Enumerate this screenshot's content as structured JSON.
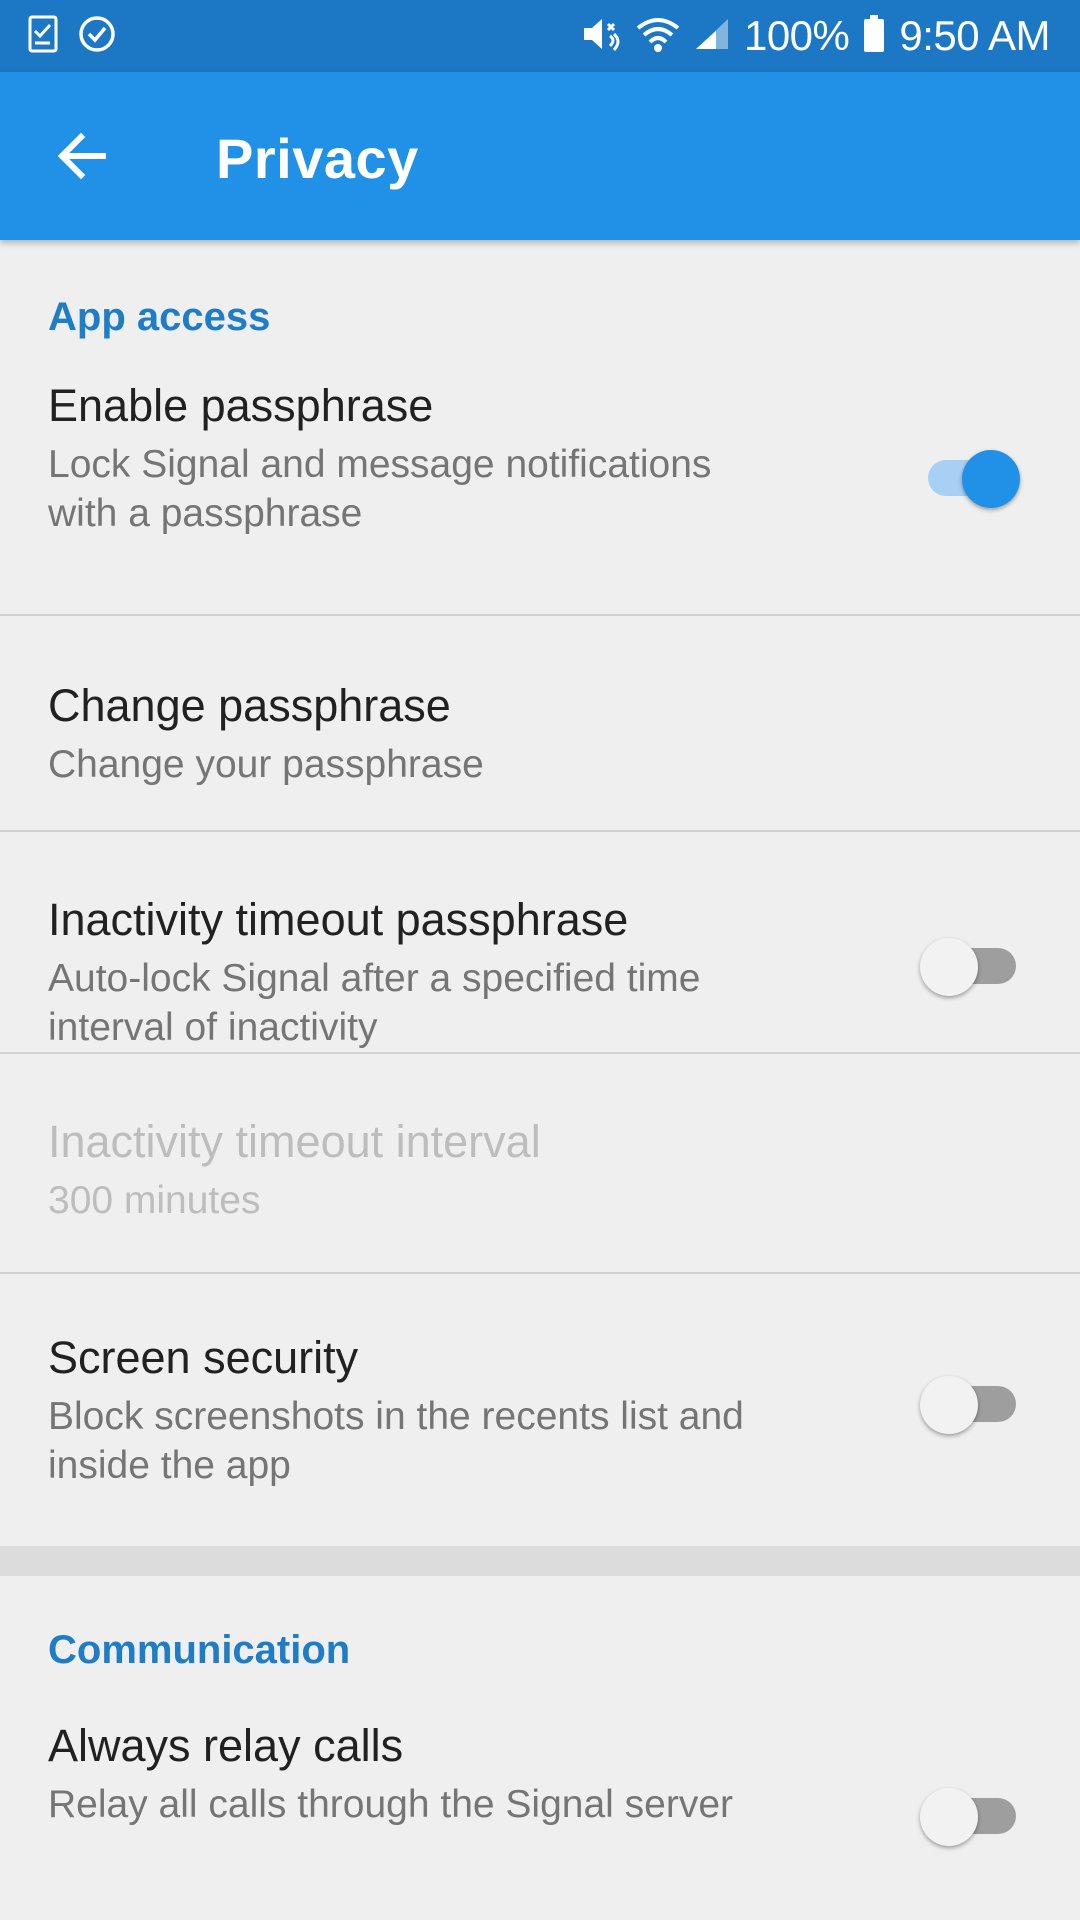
{
  "status_bar": {
    "battery": "100%",
    "time": "9:50 AM",
    "icons": [
      "task-check-icon",
      "check-circle-icon",
      "mute-vibrate-icon",
      "wifi-icon",
      "signal-icon",
      "battery-icon"
    ]
  },
  "app_bar": {
    "title": "Privacy",
    "back_icon": "arrow-left-icon",
    "color": "#2191e8"
  },
  "sections": {
    "app_access": {
      "header": "App access",
      "items": [
        {
          "title": "Enable passphrase",
          "summary_line1": "Lock Signal and message notifications",
          "summary_line2": "with a passphrase",
          "switch": "on"
        },
        {
          "title": "Change passphrase",
          "summary_line1": "Change your passphrase"
        },
        {
          "title": "Inactivity timeout passphrase",
          "summary_line1": "Auto-lock Signal after a specified time",
          "summary_line2": "interval of inactivity",
          "switch": "off"
        },
        {
          "title": "Inactivity timeout interval",
          "summary_line1": "300 minutes",
          "enabled": false
        },
        {
          "title": "Screen security",
          "summary_line1": "Block screenshots in the recents list and",
          "summary_line2": "inside the app",
          "switch": "off"
        }
      ]
    },
    "communication": {
      "header": "Communication",
      "items": [
        {
          "title": "Always relay calls",
          "summary_line1": "Relay all calls through the Signal server",
          "switch": "off"
        }
      ]
    }
  },
  "colors": {
    "accent": "#2191e8",
    "status_bar": "#1c78c4",
    "category_text": "#1f7dc7",
    "background": "#efefef"
  }
}
